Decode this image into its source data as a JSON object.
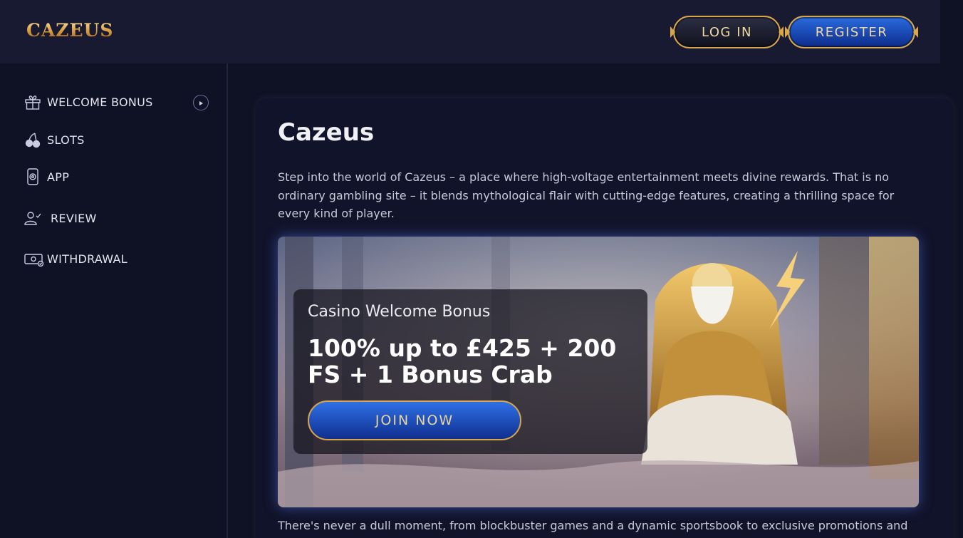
{
  "header": {
    "logo": "CAZEUS",
    "login_label": "LOG IN",
    "register_label": "REGISTER"
  },
  "sidebar": {
    "items": [
      {
        "label": "WELCOME BONUS",
        "icon": "gift-icon"
      },
      {
        "label": "SLOTS",
        "icon": "cherries-icon"
      },
      {
        "label": "APP",
        "icon": "phone-icon"
      },
      {
        "label": "REVIEW",
        "icon": "user-check-icon"
      },
      {
        "label": "WITHDRAWAL",
        "icon": "cash-icon"
      }
    ]
  },
  "main": {
    "title": "Cazeus",
    "intro": "Step into the world of Cazeus – a place where high-voltage entertainment meets divine rewards. That is no ordinary gambling site – it blends mythological flair with cutting-edge features, creating a thrilling space for every kind of player.",
    "hero": {
      "subtitle": "Casino Welcome Bonus",
      "offer": "100% up to £425 + 200 FS + 1 Bonus Crab",
      "button_label": "JOIN NOW"
    },
    "bottom_text": "There's never a dull moment, from blockbuster games and a dynamic sportsbook to exclusive promotions and"
  },
  "colors": {
    "background": "#0f1124",
    "header": "#171a30",
    "gold": "#d9a64a",
    "blue_button": "#1e4fc0"
  }
}
